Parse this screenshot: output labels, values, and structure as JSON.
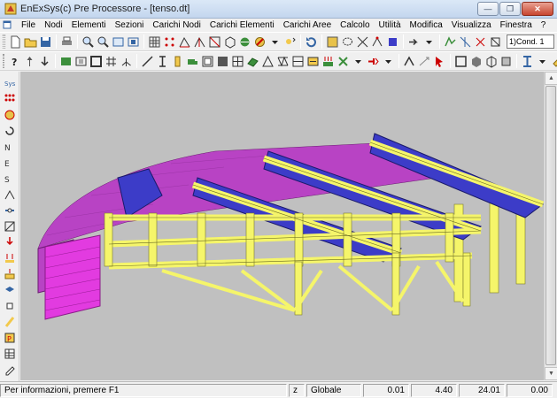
{
  "window": {
    "title": "EnExSys(c) Pre Processore - [tenso.dt]",
    "min_glyph": "—",
    "max_glyph": "❐",
    "close_glyph": "✕"
  },
  "menu": {
    "items": [
      "File",
      "Nodi",
      "Elementi",
      "Sezioni",
      "Carichi Nodi",
      "Carichi Elementi",
      "Carichi Aree",
      "Calcolo",
      "Utilità",
      "Modifica",
      "Visualizza",
      "Finestra",
      "?"
    ]
  },
  "toolbar": {
    "load_case_combo": "1)Cond. 1"
  },
  "status": {
    "message": "Per informazioni, premere F1",
    "axis": "z",
    "reference": "Globale",
    "val1": "0.01",
    "val2": "4.40",
    "val3": "24.01",
    "val4": "0.00"
  },
  "colors": {
    "structure_yellow": "#f5f56a",
    "deck_blue": "#3c3cc8",
    "surface_magenta": "#b843c4",
    "stair_magenta": "#e23be0",
    "background": "#c0c0c0"
  }
}
